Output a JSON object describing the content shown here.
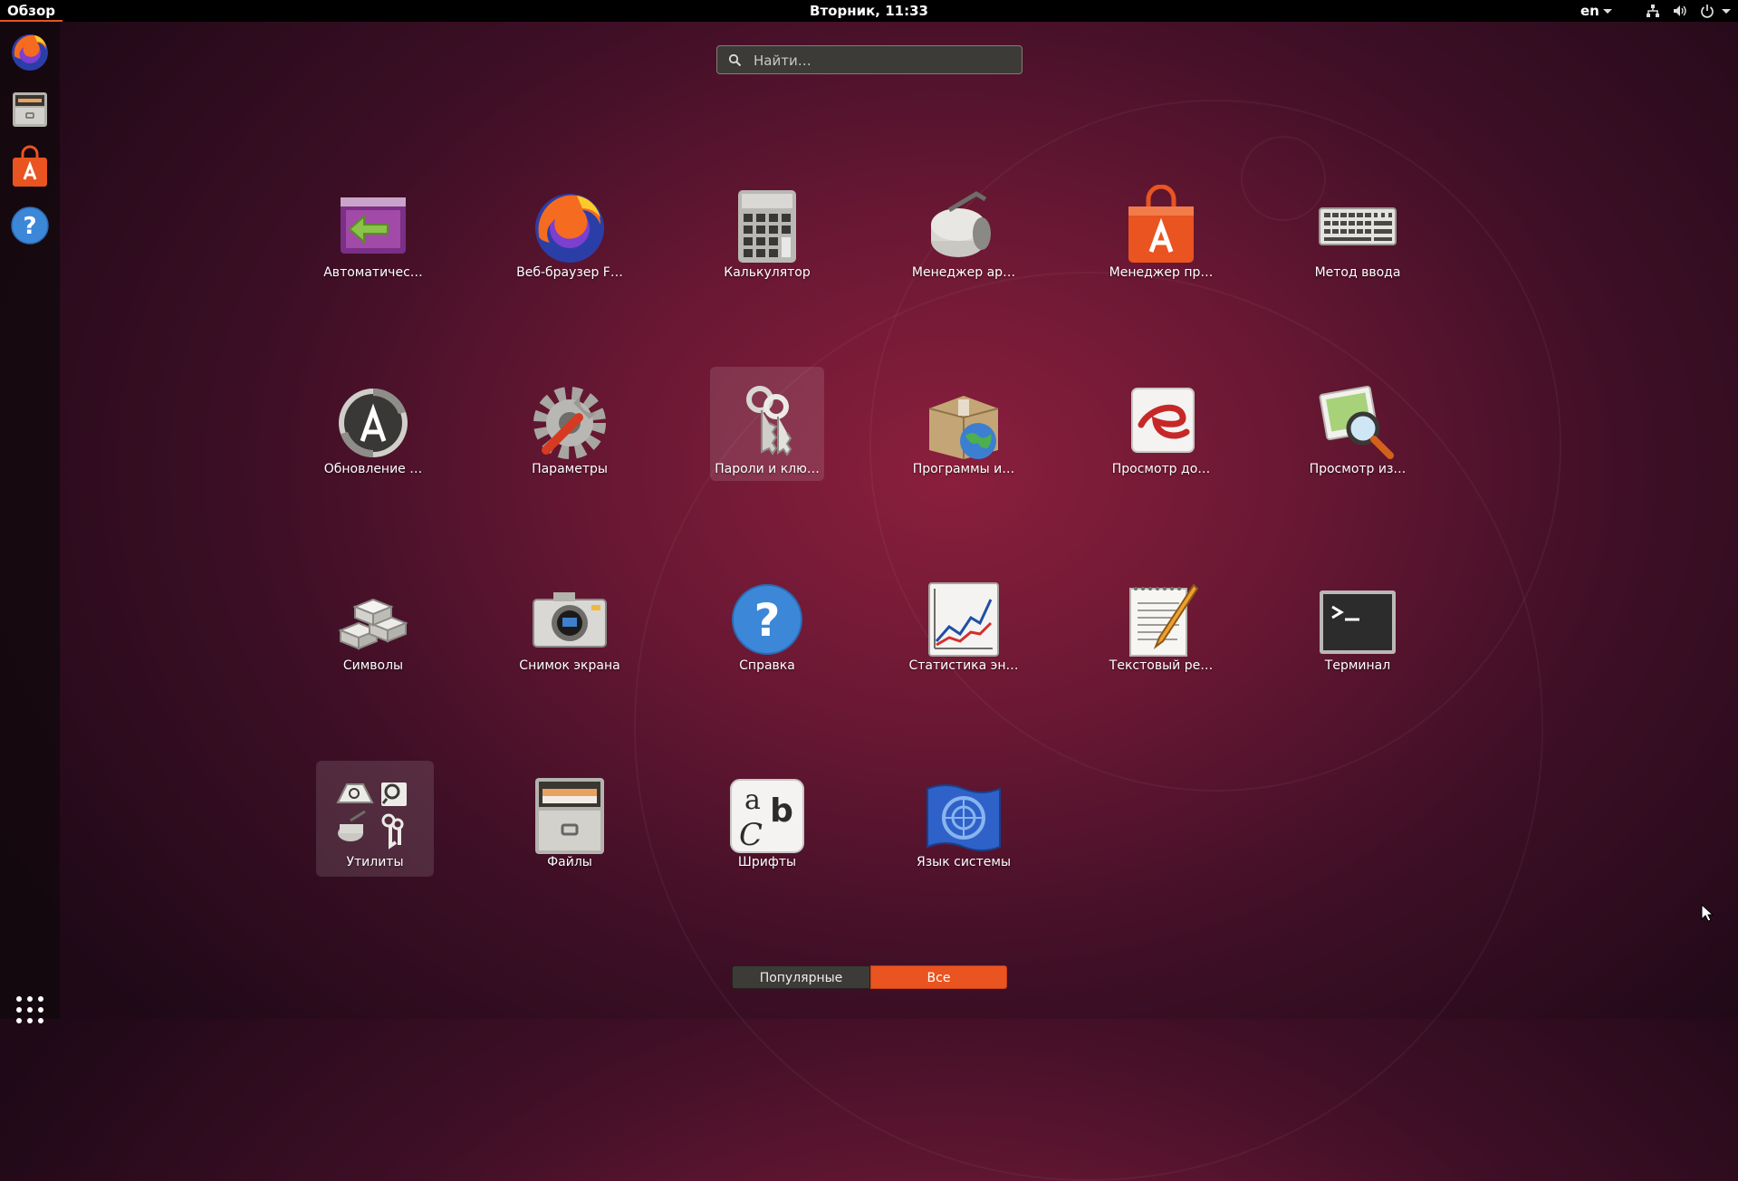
{
  "top_bar": {
    "activities_label": "Обзор",
    "clock": "Вторник, 11:33",
    "language": "en",
    "tray_icons": [
      "network-icon",
      "volume-icon",
      "power-icon"
    ]
  },
  "dock": {
    "items": [
      {
        "name": "firefox-icon"
      },
      {
        "name": "files-icon"
      },
      {
        "name": "software-center-icon"
      },
      {
        "name": "help-icon"
      }
    ],
    "show_apps_icon": "app-grid-icon"
  },
  "search": {
    "placeholder": "Найти…"
  },
  "apps": [
    {
      "label": "Автоматичес…",
      "icon": "startup-applications-icon"
    },
    {
      "label": "Веб-браузер F…",
      "icon": "firefox-icon"
    },
    {
      "label": "Калькулятор",
      "icon": "calculator-icon"
    },
    {
      "label": "Менеджер ар…",
      "icon": "archive-manager-icon"
    },
    {
      "label": "Менеджер пр…",
      "icon": "software-center-icon"
    },
    {
      "label": "Метод ввода",
      "icon": "keyboard-icon"
    },
    {
      "label": "Обновление …",
      "icon": "software-updater-icon"
    },
    {
      "label": "Параметры",
      "icon": "settings-icon"
    },
    {
      "label": "Пароли и клю…",
      "icon": "keys-icon"
    },
    {
      "label": "Программы и…",
      "icon": "software-properties-icon"
    },
    {
      "label": "Просмотр до…",
      "icon": "document-viewer-icon"
    },
    {
      "label": "Просмотр из…",
      "icon": "image-viewer-icon"
    },
    {
      "label": "Символы",
      "icon": "characters-icon"
    },
    {
      "label": "Снимок экрана",
      "icon": "screenshot-icon"
    },
    {
      "label": "Справка",
      "icon": "help-icon"
    },
    {
      "label": "Статистика эн…",
      "icon": "power-statistics-icon"
    },
    {
      "label": "Текстовый ре…",
      "icon": "text-editor-icon"
    },
    {
      "label": "Терминал",
      "icon": "terminal-icon"
    },
    {
      "label": "Утилиты",
      "icon": "utilities-folder-icon"
    },
    {
      "label": "Файлы",
      "icon": "files-icon"
    },
    {
      "label": "Шрифты",
      "icon": "fonts-icon"
    },
    {
      "label": "Язык системы",
      "icon": "language-support-icon"
    }
  ],
  "view_toggle": {
    "frequent_label": "Популярные",
    "all_label": "Все",
    "active": "all"
  },
  "colors": {
    "accent": "#e95420",
    "topbar": "#000000",
    "dock": "#1a0b13"
  }
}
